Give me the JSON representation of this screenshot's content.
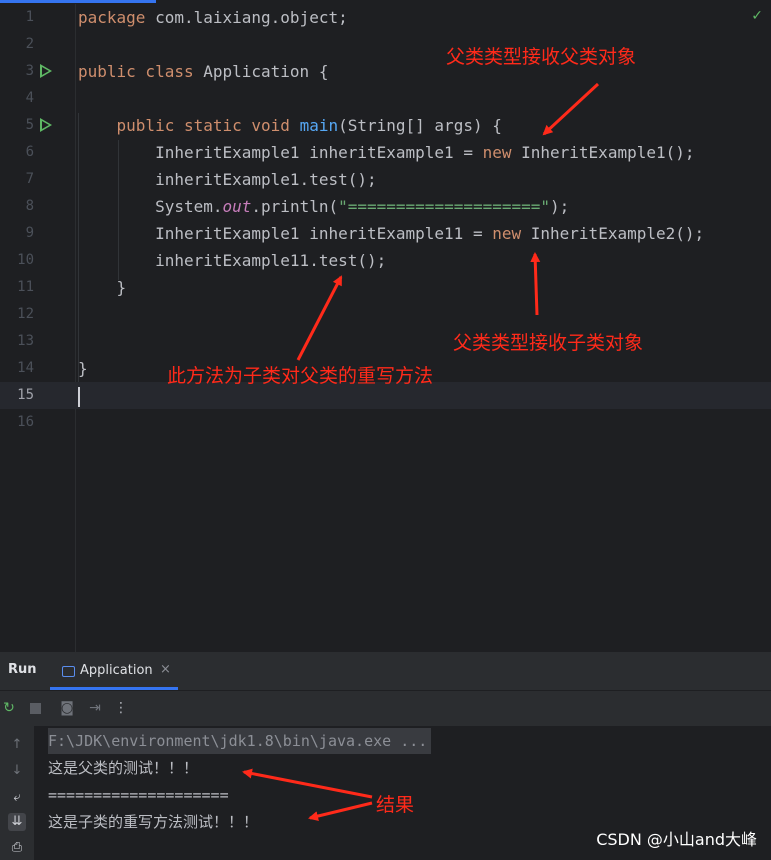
{
  "editor": {
    "line_numbers": [
      "1",
      "2",
      "3",
      "4",
      "5",
      "6",
      "7",
      "8",
      "9",
      "10",
      "11",
      "12",
      "13",
      "14",
      "15",
      "16"
    ],
    "code": {
      "l1_kw": "package",
      "l1_rest": " com.laixiang.object;",
      "l3_kw": "public class",
      "l3_rest": " Application {",
      "l5_indent": "    ",
      "l5_kw": "public static void",
      "l5_sp": " ",
      "l5_fn": "main",
      "l5_rest": "(String[] args) {",
      "l6_a": "        InheritExample1 inheritExample1 = ",
      "l6_kw": "new",
      "l6_b": " InheritExample1();",
      "l7": "        inheritExample1.test();",
      "l8_a": "        System.",
      "l8_field": "out",
      "l8_b": ".println(",
      "l8_str": "\"====================\"",
      "l8_c": ");",
      "l9_a": "        InheritExample1 inheritExample11 = ",
      "l9_kw": "new",
      "l9_b": " InheritExample2();",
      "l10": "        inheritExample11.test();",
      "l11": "    }",
      "l14": "}"
    }
  },
  "annotations": {
    "parent_receives_parent": "父类类型接收父类对象",
    "parent_receives_child": "父类类型接收子类对象",
    "override_note": "此方法为子类对父类的重写方法",
    "result": "结果"
  },
  "run_panel": {
    "title": "Run",
    "tab_label": "Application",
    "tab_close": "×",
    "console_lines": [
      "F:\\JDK\\environment\\jdk1.8\\bin\\java.exe ...",
      "这是父类的测试！！！",
      "====================",
      "这是子类的重写方法测试！！！"
    ]
  },
  "watermark": "CSDN @小山and大峰",
  "colors": {
    "accent": "#3574f0",
    "annotation_red": "#ff2a1a",
    "run_green": "#5fb865"
  },
  "icons": [
    "check-icon",
    "run-gutter-icon",
    "rerun-icon",
    "stop-icon",
    "camera-icon",
    "exit-icon",
    "more-icon",
    "up-arrow-icon",
    "down-arrow-icon",
    "soft-wrap-icon",
    "scroll-to-end-icon",
    "print-icon",
    "application-tab-icon"
  ]
}
